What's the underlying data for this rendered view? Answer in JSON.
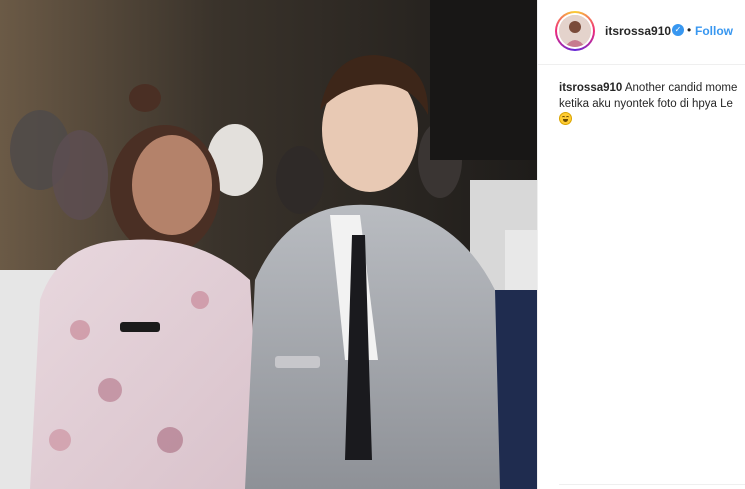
{
  "post": {
    "username": "itsrossa910",
    "follow_label": "Follow",
    "separator": "•",
    "verified_mark": "✓",
    "caption": {
      "username": "itsrossa910",
      "line1": "Another candid mome",
      "line2": "ketika aku nyontek foto di hpya Le"
    },
    "emoji": "face-with-tears-of-joy-icon"
  },
  "colors": {
    "accent": "#3897f0",
    "text": "#262626",
    "border": "#efefef"
  }
}
